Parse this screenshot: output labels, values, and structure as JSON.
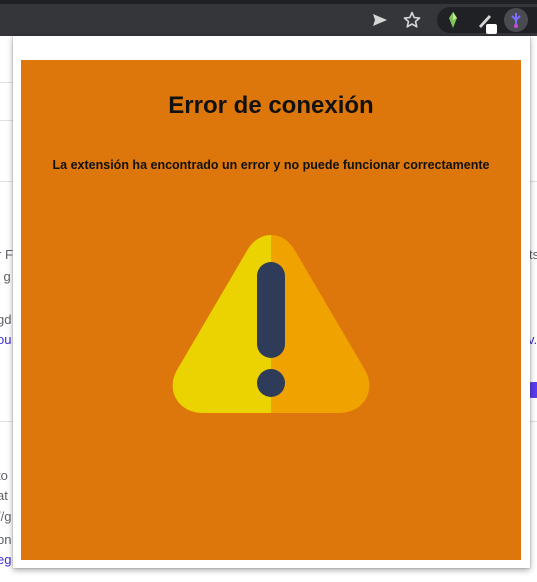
{
  "popup": {
    "title": "Error de conexión",
    "message": "La extensión ha encontrado un error y no puede funcionar correctamente",
    "icon": "warning-triangle-icon",
    "background_color": "#de770b"
  },
  "background_page": {
    "left_fragments": [
      "r F",
      "l g",
      "gd",
      "ou",
      "to",
      "at",
      "//g",
      "bn",
      "eg"
    ],
    "right_fragments": [
      "ts",
      "v."
    ]
  }
}
